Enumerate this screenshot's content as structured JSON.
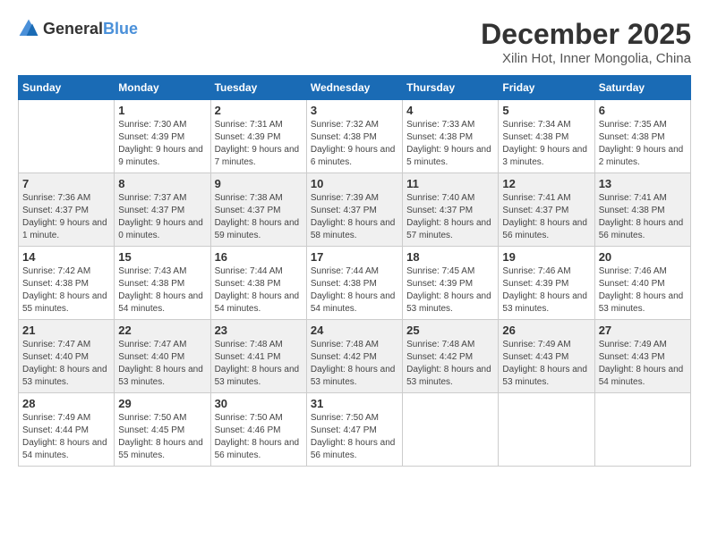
{
  "header": {
    "logo_general": "General",
    "logo_blue": "Blue",
    "month_title": "December 2025",
    "location": "Xilin Hot, Inner Mongolia, China"
  },
  "weekdays": [
    "Sunday",
    "Monday",
    "Tuesday",
    "Wednesday",
    "Thursday",
    "Friday",
    "Saturday"
  ],
  "weeks": [
    [
      {
        "day": "",
        "sunrise": "",
        "sunset": "",
        "daylight": ""
      },
      {
        "day": "1",
        "sunrise": "Sunrise: 7:30 AM",
        "sunset": "Sunset: 4:39 PM",
        "daylight": "Daylight: 9 hours and 9 minutes."
      },
      {
        "day": "2",
        "sunrise": "Sunrise: 7:31 AM",
        "sunset": "Sunset: 4:39 PM",
        "daylight": "Daylight: 9 hours and 7 minutes."
      },
      {
        "day": "3",
        "sunrise": "Sunrise: 7:32 AM",
        "sunset": "Sunset: 4:38 PM",
        "daylight": "Daylight: 9 hours and 6 minutes."
      },
      {
        "day": "4",
        "sunrise": "Sunrise: 7:33 AM",
        "sunset": "Sunset: 4:38 PM",
        "daylight": "Daylight: 9 hours and 5 minutes."
      },
      {
        "day": "5",
        "sunrise": "Sunrise: 7:34 AM",
        "sunset": "Sunset: 4:38 PM",
        "daylight": "Daylight: 9 hours and 3 minutes."
      },
      {
        "day": "6",
        "sunrise": "Sunrise: 7:35 AM",
        "sunset": "Sunset: 4:38 PM",
        "daylight": "Daylight: 9 hours and 2 minutes."
      }
    ],
    [
      {
        "day": "7",
        "sunrise": "Sunrise: 7:36 AM",
        "sunset": "Sunset: 4:37 PM",
        "daylight": "Daylight: 9 hours and 1 minute."
      },
      {
        "day": "8",
        "sunrise": "Sunrise: 7:37 AM",
        "sunset": "Sunset: 4:37 PM",
        "daylight": "Daylight: 9 hours and 0 minutes."
      },
      {
        "day": "9",
        "sunrise": "Sunrise: 7:38 AM",
        "sunset": "Sunset: 4:37 PM",
        "daylight": "Daylight: 8 hours and 59 minutes."
      },
      {
        "day": "10",
        "sunrise": "Sunrise: 7:39 AM",
        "sunset": "Sunset: 4:37 PM",
        "daylight": "Daylight: 8 hours and 58 minutes."
      },
      {
        "day": "11",
        "sunrise": "Sunrise: 7:40 AM",
        "sunset": "Sunset: 4:37 PM",
        "daylight": "Daylight: 8 hours and 57 minutes."
      },
      {
        "day": "12",
        "sunrise": "Sunrise: 7:41 AM",
        "sunset": "Sunset: 4:37 PM",
        "daylight": "Daylight: 8 hours and 56 minutes."
      },
      {
        "day": "13",
        "sunrise": "Sunrise: 7:41 AM",
        "sunset": "Sunset: 4:38 PM",
        "daylight": "Daylight: 8 hours and 56 minutes."
      }
    ],
    [
      {
        "day": "14",
        "sunrise": "Sunrise: 7:42 AM",
        "sunset": "Sunset: 4:38 PM",
        "daylight": "Daylight: 8 hours and 55 minutes."
      },
      {
        "day": "15",
        "sunrise": "Sunrise: 7:43 AM",
        "sunset": "Sunset: 4:38 PM",
        "daylight": "Daylight: 8 hours and 54 minutes."
      },
      {
        "day": "16",
        "sunrise": "Sunrise: 7:44 AM",
        "sunset": "Sunset: 4:38 PM",
        "daylight": "Daylight: 8 hours and 54 minutes."
      },
      {
        "day": "17",
        "sunrise": "Sunrise: 7:44 AM",
        "sunset": "Sunset: 4:38 PM",
        "daylight": "Daylight: 8 hours and 54 minutes."
      },
      {
        "day": "18",
        "sunrise": "Sunrise: 7:45 AM",
        "sunset": "Sunset: 4:39 PM",
        "daylight": "Daylight: 8 hours and 53 minutes."
      },
      {
        "day": "19",
        "sunrise": "Sunrise: 7:46 AM",
        "sunset": "Sunset: 4:39 PM",
        "daylight": "Daylight: 8 hours and 53 minutes."
      },
      {
        "day": "20",
        "sunrise": "Sunrise: 7:46 AM",
        "sunset": "Sunset: 4:40 PM",
        "daylight": "Daylight: 8 hours and 53 minutes."
      }
    ],
    [
      {
        "day": "21",
        "sunrise": "Sunrise: 7:47 AM",
        "sunset": "Sunset: 4:40 PM",
        "daylight": "Daylight: 8 hours and 53 minutes."
      },
      {
        "day": "22",
        "sunrise": "Sunrise: 7:47 AM",
        "sunset": "Sunset: 4:40 PM",
        "daylight": "Daylight: 8 hours and 53 minutes."
      },
      {
        "day": "23",
        "sunrise": "Sunrise: 7:48 AM",
        "sunset": "Sunset: 4:41 PM",
        "daylight": "Daylight: 8 hours and 53 minutes."
      },
      {
        "day": "24",
        "sunrise": "Sunrise: 7:48 AM",
        "sunset": "Sunset: 4:42 PM",
        "daylight": "Daylight: 8 hours and 53 minutes."
      },
      {
        "day": "25",
        "sunrise": "Sunrise: 7:48 AM",
        "sunset": "Sunset: 4:42 PM",
        "daylight": "Daylight: 8 hours and 53 minutes."
      },
      {
        "day": "26",
        "sunrise": "Sunrise: 7:49 AM",
        "sunset": "Sunset: 4:43 PM",
        "daylight": "Daylight: 8 hours and 53 minutes."
      },
      {
        "day": "27",
        "sunrise": "Sunrise: 7:49 AM",
        "sunset": "Sunset: 4:43 PM",
        "daylight": "Daylight: 8 hours and 54 minutes."
      }
    ],
    [
      {
        "day": "28",
        "sunrise": "Sunrise: 7:49 AM",
        "sunset": "Sunset: 4:44 PM",
        "daylight": "Daylight: 8 hours and 54 minutes."
      },
      {
        "day": "29",
        "sunrise": "Sunrise: 7:50 AM",
        "sunset": "Sunset: 4:45 PM",
        "daylight": "Daylight: 8 hours and 55 minutes."
      },
      {
        "day": "30",
        "sunrise": "Sunrise: 7:50 AM",
        "sunset": "Sunset: 4:46 PM",
        "daylight": "Daylight: 8 hours and 56 minutes."
      },
      {
        "day": "31",
        "sunrise": "Sunrise: 7:50 AM",
        "sunset": "Sunset: 4:47 PM",
        "daylight": "Daylight: 8 hours and 56 minutes."
      },
      {
        "day": "",
        "sunrise": "",
        "sunset": "",
        "daylight": ""
      },
      {
        "day": "",
        "sunrise": "",
        "sunset": "",
        "daylight": ""
      },
      {
        "day": "",
        "sunrise": "",
        "sunset": "",
        "daylight": ""
      }
    ]
  ]
}
